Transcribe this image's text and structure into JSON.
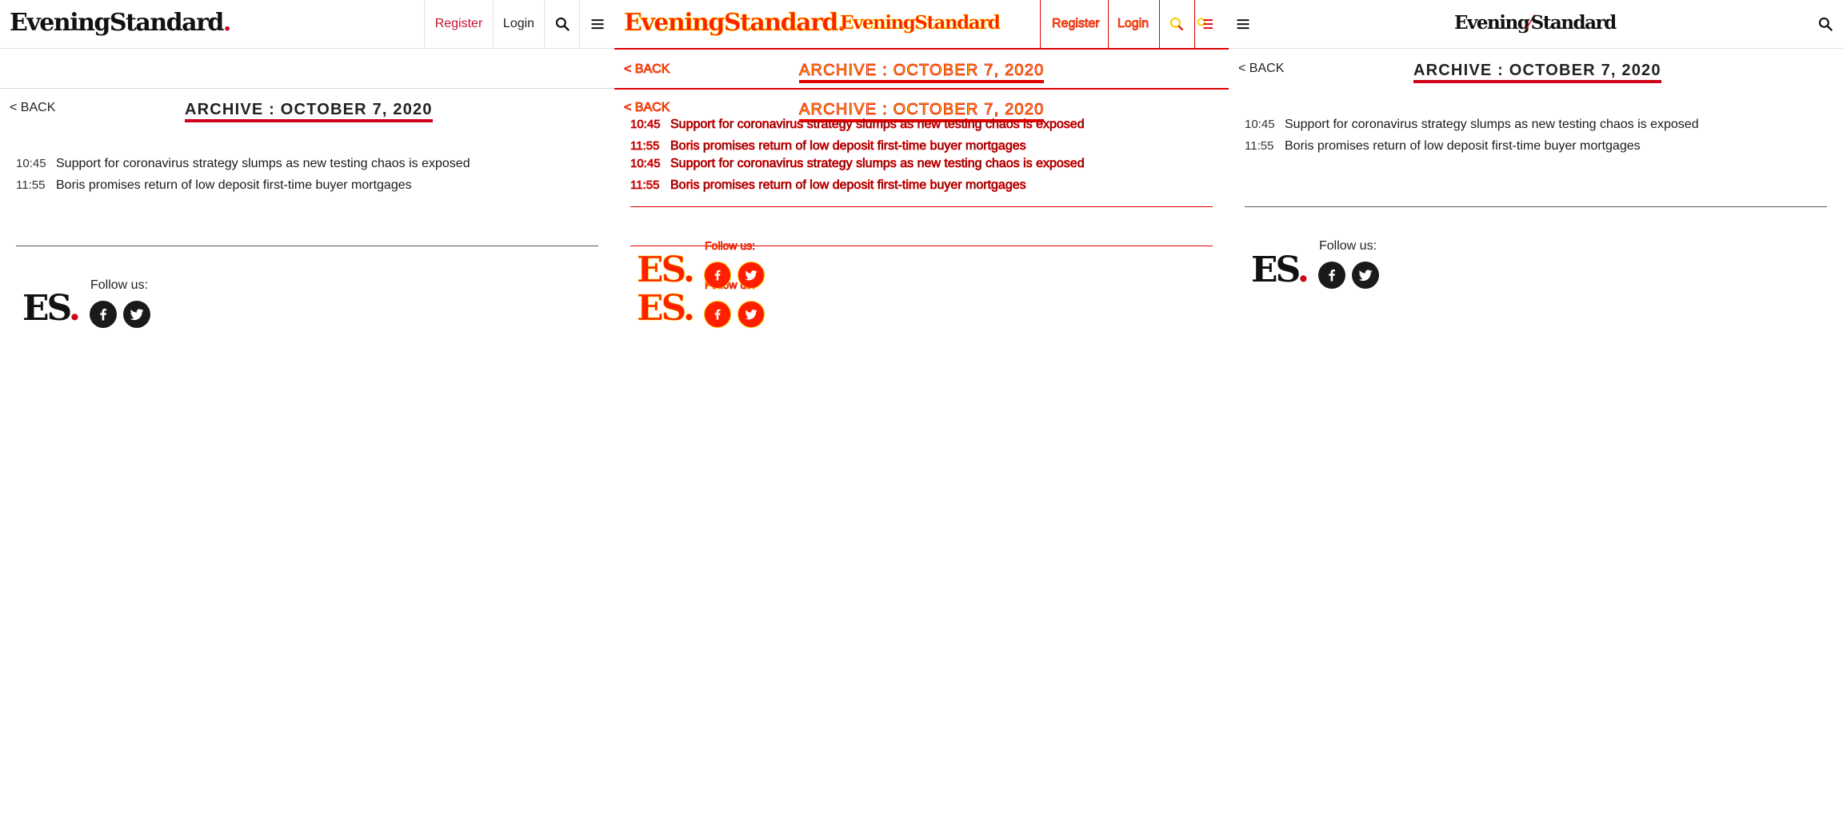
{
  "brand": {
    "logo_text": "EveningStandard",
    "logo_dot": ".",
    "logo_word1": "Evening",
    "logo_word2": "Standard",
    "es_letters": "ES",
    "es_dot": "."
  },
  "nav": {
    "register": "Register",
    "login": "Login"
  },
  "page": {
    "back": "< BACK",
    "title": "ARCHIVE : OCTOBER 7, 2020"
  },
  "articles": [
    {
      "time": "10:45",
      "headline": "Support for coronavirus strategy slumps as new testing chaos is exposed"
    },
    {
      "time": "11:55",
      "headline": "Boris promises return of low deposit first-time buyer mortgages"
    }
  ],
  "footer": {
    "follow": "Follow us:",
    "social": [
      "facebook-icon",
      "twitter-icon"
    ]
  },
  "colors": {
    "brand_red": "#d0021b",
    "overlay_yellow": "#ffcc00",
    "overlay_red": "#e60000"
  }
}
